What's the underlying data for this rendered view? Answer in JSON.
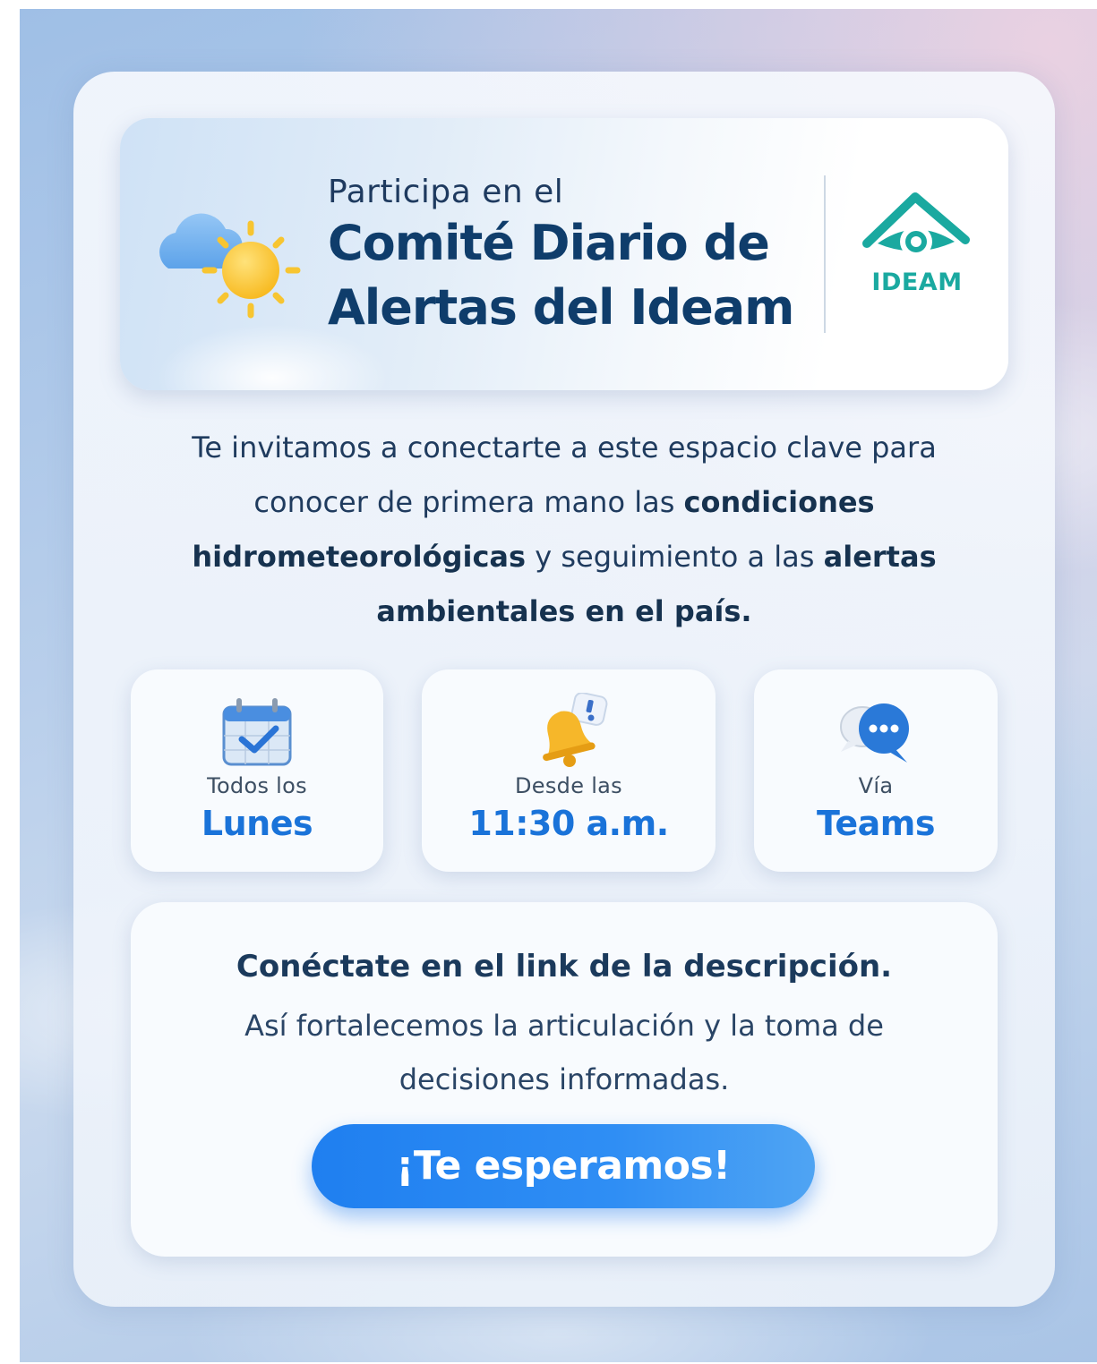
{
  "header": {
    "intro": "Participa en el",
    "title_line1": "Comité Diario de",
    "title_line2": "Alertas del Ideam",
    "logo_text": "IDEAM",
    "weather_icon": "sun-cloud-icon",
    "logo_icon": "ideam-eye-logo"
  },
  "description": {
    "p1": "Te invitamos a conectarte a este espacio clave para conocer de primera mano las ",
    "b1": "condiciones hidrometeorológicas",
    "p2": " y seguimiento a las ",
    "b2": "alertas ambientales en el país."
  },
  "info_cards": [
    {
      "icon": "calendar-check-icon",
      "small": "Todos los",
      "big": "Lunes"
    },
    {
      "icon": "bell-alert-icon",
      "small": "Desde las",
      "big": "11:30 a.m."
    },
    {
      "icon": "chat-bubbles-icon",
      "small": "Vía",
      "big": "Teams"
    }
  ],
  "cta": {
    "title": "Conéctate en el link de la descripción.",
    "body": "Así fortalecemos la articulación y la toma de decisiones informadas.",
    "button": "¡Te esperamos!"
  },
  "colors": {
    "accent": "#1a73d9",
    "title": "#0f3d6b",
    "logo": "#1aa9a0",
    "button": "#1f7ff0"
  }
}
